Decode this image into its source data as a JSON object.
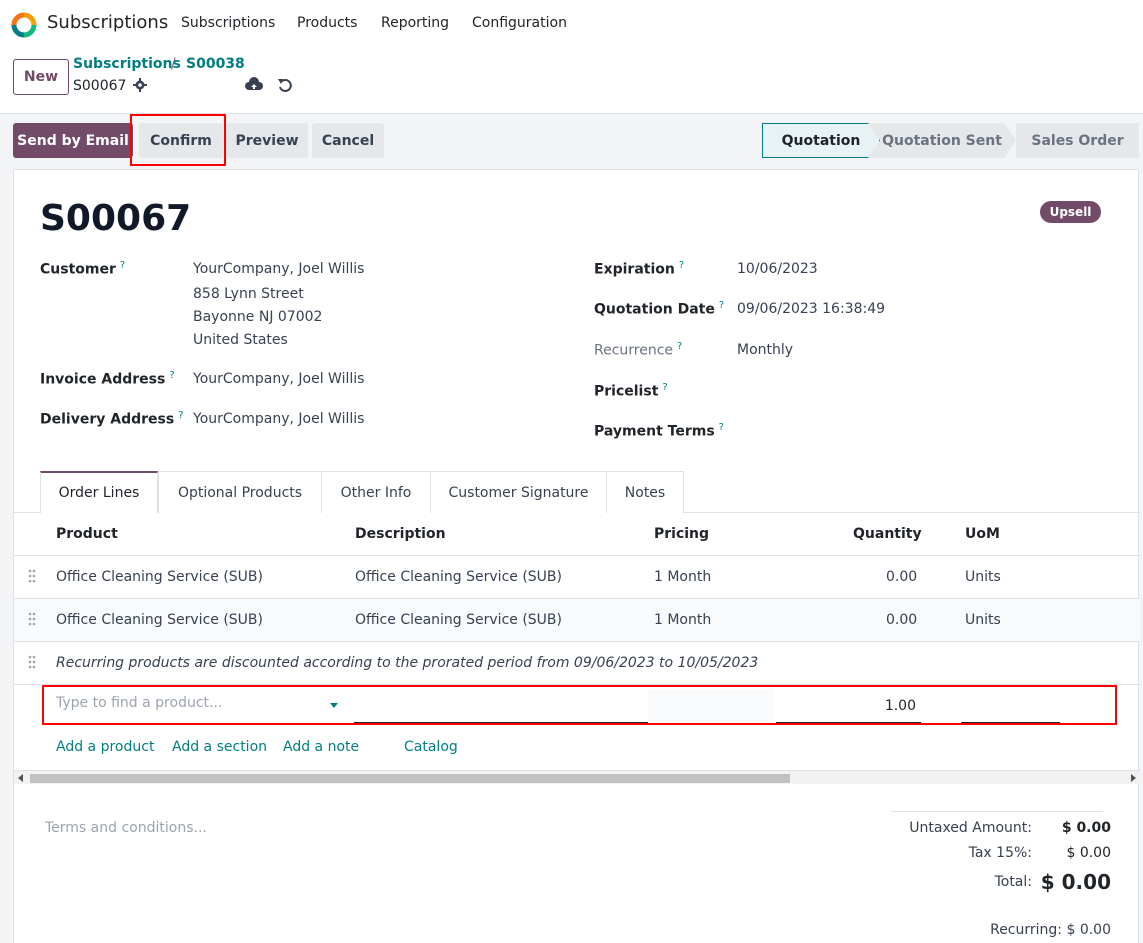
{
  "navbar": {
    "app_name": "Subscriptions",
    "menu": [
      "Subscriptions",
      "Products",
      "Reporting",
      "Configuration"
    ]
  },
  "control": {
    "new_label": "New",
    "breadcrumb_parent": "Subscriptions",
    "breadcrumb_sep": "/",
    "breadcrumb_current": "S00038",
    "record_name": "S00067"
  },
  "actions": {
    "send_email": "Send by Email",
    "confirm": "Confirm",
    "preview": "Preview",
    "cancel": "Cancel"
  },
  "status": {
    "stages": [
      "Quotation",
      "Quotation Sent",
      "Sales Order"
    ],
    "active": "Quotation"
  },
  "form": {
    "badge": "Upsell",
    "title": "S00067",
    "customer_label": "Customer",
    "customer_lines": [
      "YourCompany, Joel Willis",
      "858 Lynn Street",
      "Bayonne NJ 07002",
      "United States"
    ],
    "invoice_label": "Invoice Address",
    "invoice_value": "YourCompany, Joel Willis",
    "delivery_label": "Delivery Address",
    "delivery_value": "YourCompany, Joel Willis",
    "expiration_label": "Expiration",
    "expiration_value": "10/06/2023",
    "quotation_date_label": "Quotation Date",
    "quotation_date_value": "09/06/2023 16:38:49",
    "recurrence_label": "Recurrence",
    "recurrence_value": "Monthly",
    "pricelist_label": "Pricelist",
    "payment_terms_label": "Payment Terms",
    "help_mark": "?"
  },
  "tabs": [
    "Order Lines",
    "Optional Products",
    "Other Info",
    "Customer Signature",
    "Notes"
  ],
  "table": {
    "headers": [
      "Product",
      "Description",
      "Pricing",
      "Quantity",
      "UoM"
    ],
    "rows": [
      {
        "product": "Office Cleaning Service (SUB)",
        "description": "Office Cleaning Service (SUB)",
        "pricing": "1 Month",
        "quantity": "0.00",
        "uom": "Units"
      },
      {
        "product": "Office Cleaning Service (SUB)",
        "description": "Office Cleaning Service (SUB)",
        "pricing": "1 Month",
        "quantity": "0.00",
        "uom": "Units"
      }
    ],
    "note": "Recurring products are discounted according to the prorated period from 09/06/2023 to 10/05/2023",
    "new_line": {
      "placeholder": "Type to find a product...",
      "quantity": "1.00"
    },
    "links": [
      "Add a product",
      "Add a section",
      "Add a note",
      "Catalog"
    ]
  },
  "footer": {
    "terms_placeholder": "Terms and conditions...",
    "untaxed_label": "Untaxed Amount:",
    "untaxed_value": "$ 0.00",
    "tax_label": "Tax 15%:",
    "tax_value": "$ 0.00",
    "total_label": "Total:",
    "total_value": "$ 0.00",
    "recurring": "Recurring: $ 0.00"
  },
  "colors": {
    "brand": "#714b67",
    "accent": "#017e84",
    "highlight": "#ff0000"
  }
}
